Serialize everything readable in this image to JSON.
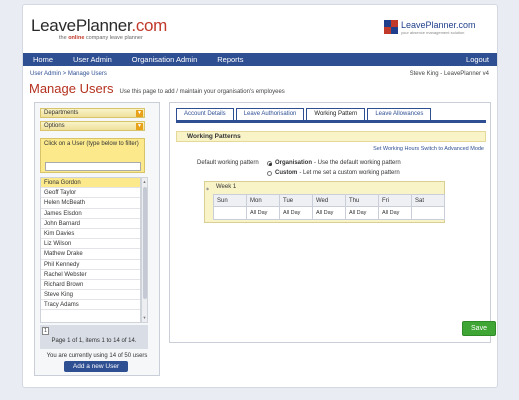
{
  "header": {
    "brand_main": "LeavePlanner",
    "brand_suffix": ".com",
    "tagline_pre": "the",
    "tagline_red": "online",
    "tagline_post": "company leave planner",
    "brand2": "LeavePlanner.com",
    "brand2_sub": "your absence management solution"
  },
  "nav": {
    "items": [
      "Home",
      "User Admin",
      "Organisation Admin",
      "Reports"
    ],
    "logout": "Logout"
  },
  "breadcrumb": "User Admin > Manage Users",
  "user_info": "Steve King - LeavePlanner v4",
  "page": {
    "title": "Manage Users",
    "description": "Use this page to add / maintain your organisation's employees"
  },
  "left": {
    "departments": "Departments",
    "options": "Options",
    "filter_hint": "Click on a User (type below to filter)",
    "users": [
      "Fiona Gordon",
      "Geoff Taylor",
      "Helen McBeath",
      "James Elsdon",
      "John Barnard",
      "Kim Davies",
      "Liz Wilson",
      "Mathew Drake",
      "Phil Kennedy",
      "Rachel Webster",
      "Richard Brown",
      "Steve King",
      "Tracy Adams"
    ],
    "pager_first": "1",
    "pager_text": "Page 1 of 1, items 1 to 14 of 14.",
    "usage": "You are currently using 14 of 50 users",
    "add_user": "Add a new User"
  },
  "right": {
    "tabs": [
      "Account Details",
      "Leave Authorisation",
      "Working Pattern",
      "Leave Allowances"
    ],
    "section_title": "Working Patterns",
    "link_set_hours": "Set Working Hours",
    "link_advanced": "Switch to Advanced Mode",
    "default_label": "Default working pattern",
    "option_org_bold": "Organisation",
    "option_org_text": "- Use the default working pattern",
    "option_custom_bold": "Custom",
    "option_custom_text": "- Let me set a custom working pattern",
    "week_title": "Week 1",
    "days": [
      "Sun",
      "Mon",
      "Tue",
      "Wed",
      "Thu",
      "Fri",
      "Sat"
    ],
    "day_values": [
      "",
      "All Day",
      "All Day",
      "All Day",
      "All Day",
      "All Day",
      ""
    ],
    "save": "Save"
  }
}
